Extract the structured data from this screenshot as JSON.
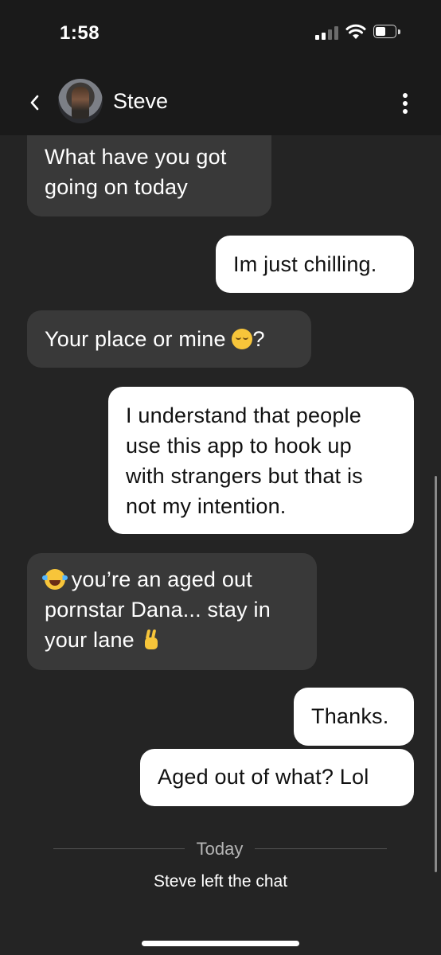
{
  "status_bar": {
    "time": "1:58",
    "battery_icon": "battery-icon",
    "wifi_icon": "wifi-icon",
    "signal_icon": "signal-icon"
  },
  "header": {
    "contact_name": "Steve",
    "back_icon": "chevron-left-icon",
    "menu_icon": "more-vertical-icon"
  },
  "messages": [
    {
      "direction": "incoming",
      "text": "What have you got going on today"
    },
    {
      "direction": "outgoing",
      "text": "Im just chilling."
    },
    {
      "direction": "incoming",
      "text": "Your place or mine",
      "emoji": "relieved-face-emoji",
      "suffix": "?"
    },
    {
      "direction": "outgoing",
      "text": "I understand that people use this app to hook up with strangers but that is not my intention."
    },
    {
      "direction": "incoming",
      "emoji": "tears-of-joy-emoji",
      "text": "you’re an aged out pornstar Dana... stay in your lane",
      "emoji2": "victory-hand-emoji"
    },
    {
      "direction": "outgoing",
      "text": "Thanks."
    },
    {
      "direction": "outgoing",
      "text": "Aged out of what? Lol"
    }
  ],
  "divider": {
    "label": "Today"
  },
  "system_message": "Steve left the chat",
  "colors": {
    "background": "#242424",
    "header": "#1a1a1a",
    "incoming_bubble": "#393939",
    "outgoing_bubble": "#ffffff"
  }
}
